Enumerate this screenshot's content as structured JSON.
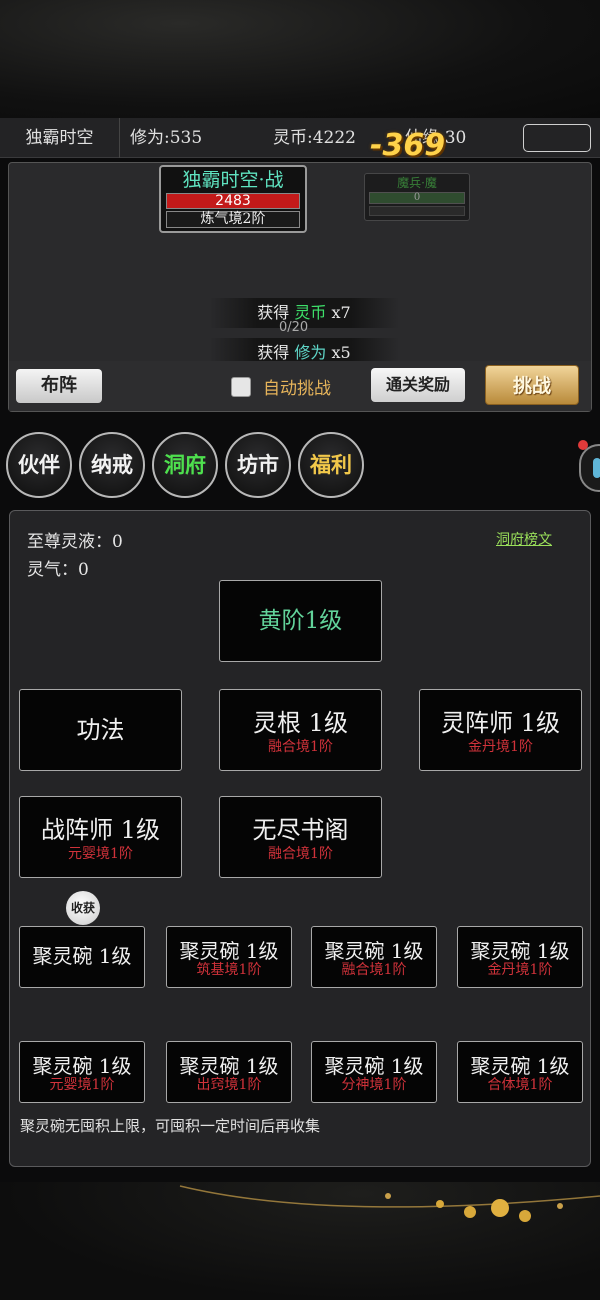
{
  "stats": {
    "player_name": "独霸时空",
    "xiuwei_label": "修为:",
    "xiuwei_value": "535",
    "lingbi_label": "灵币:",
    "lingbi_value": "4222",
    "xianyuan_label": "仙缘:",
    "xianyuan_value": "30"
  },
  "battle": {
    "damage_popup": "-369",
    "player_card": {
      "name": "独霸时空·战",
      "hp": "2483",
      "realm": "炼气境2阶"
    },
    "enemy_card": {
      "name": "魔兵·魔",
      "hp": "0"
    },
    "rewards": [
      {
        "prefix": "获得",
        "item": "灵币",
        "qty": "x7"
      },
      {
        "prefix": "获得",
        "item": "修为",
        "qty": "x5"
      }
    ],
    "progress": "0/20",
    "buzhen_label": "布阵",
    "auto_label": "自动挑战",
    "auto_checked": false,
    "clear_reward_label": "通关奖励",
    "challenge_label": "挑战"
  },
  "nav": {
    "items": [
      {
        "label": "伙伴"
      },
      {
        "label": "纳戒"
      },
      {
        "label": "洞府",
        "active": true
      },
      {
        "label": "坊市"
      },
      {
        "label": "福利"
      }
    ]
  },
  "cave": {
    "zhizun_label": "至尊灵液：0",
    "lingqi_label": "灵气：0",
    "board_link": "洞府榜文",
    "rank_tile": "黄阶1级",
    "buildings": [
      {
        "title": "功法",
        "sub": ""
      },
      {
        "title": "灵根 1级",
        "sub": "融合境1阶"
      },
      {
        "title": "灵阵师 1级",
        "sub": "金丹境1阶"
      },
      {
        "title": "战阵师 1级",
        "sub": "元婴境1阶"
      },
      {
        "title": "无尽书阁",
        "sub": "融合境1阶"
      }
    ],
    "harvest_label": "收获",
    "bowls": [
      {
        "title": "聚灵碗 1级",
        "sub": ""
      },
      {
        "title": "聚灵碗 1级",
        "sub": "筑基境1阶"
      },
      {
        "title": "聚灵碗 1级",
        "sub": "融合境1阶"
      },
      {
        "title": "聚灵碗 1级",
        "sub": "金丹境1阶"
      },
      {
        "title": "聚灵碗 1级",
        "sub": "元婴境1阶"
      },
      {
        "title": "聚灵碗 1级",
        "sub": "出窍境1阶"
      },
      {
        "title": "聚灵碗 1级",
        "sub": "分神境1阶"
      },
      {
        "title": "聚灵碗 1级",
        "sub": "合体境1阶"
      }
    ],
    "hint": "聚灵碗无囤积上限，可囤积一定时间后再收集"
  },
  "colors": {
    "accent_gold": "#f2c84a",
    "active_green": "#4ee04e",
    "hp_red": "#c31a1a",
    "realm_red": "#d0323a"
  }
}
